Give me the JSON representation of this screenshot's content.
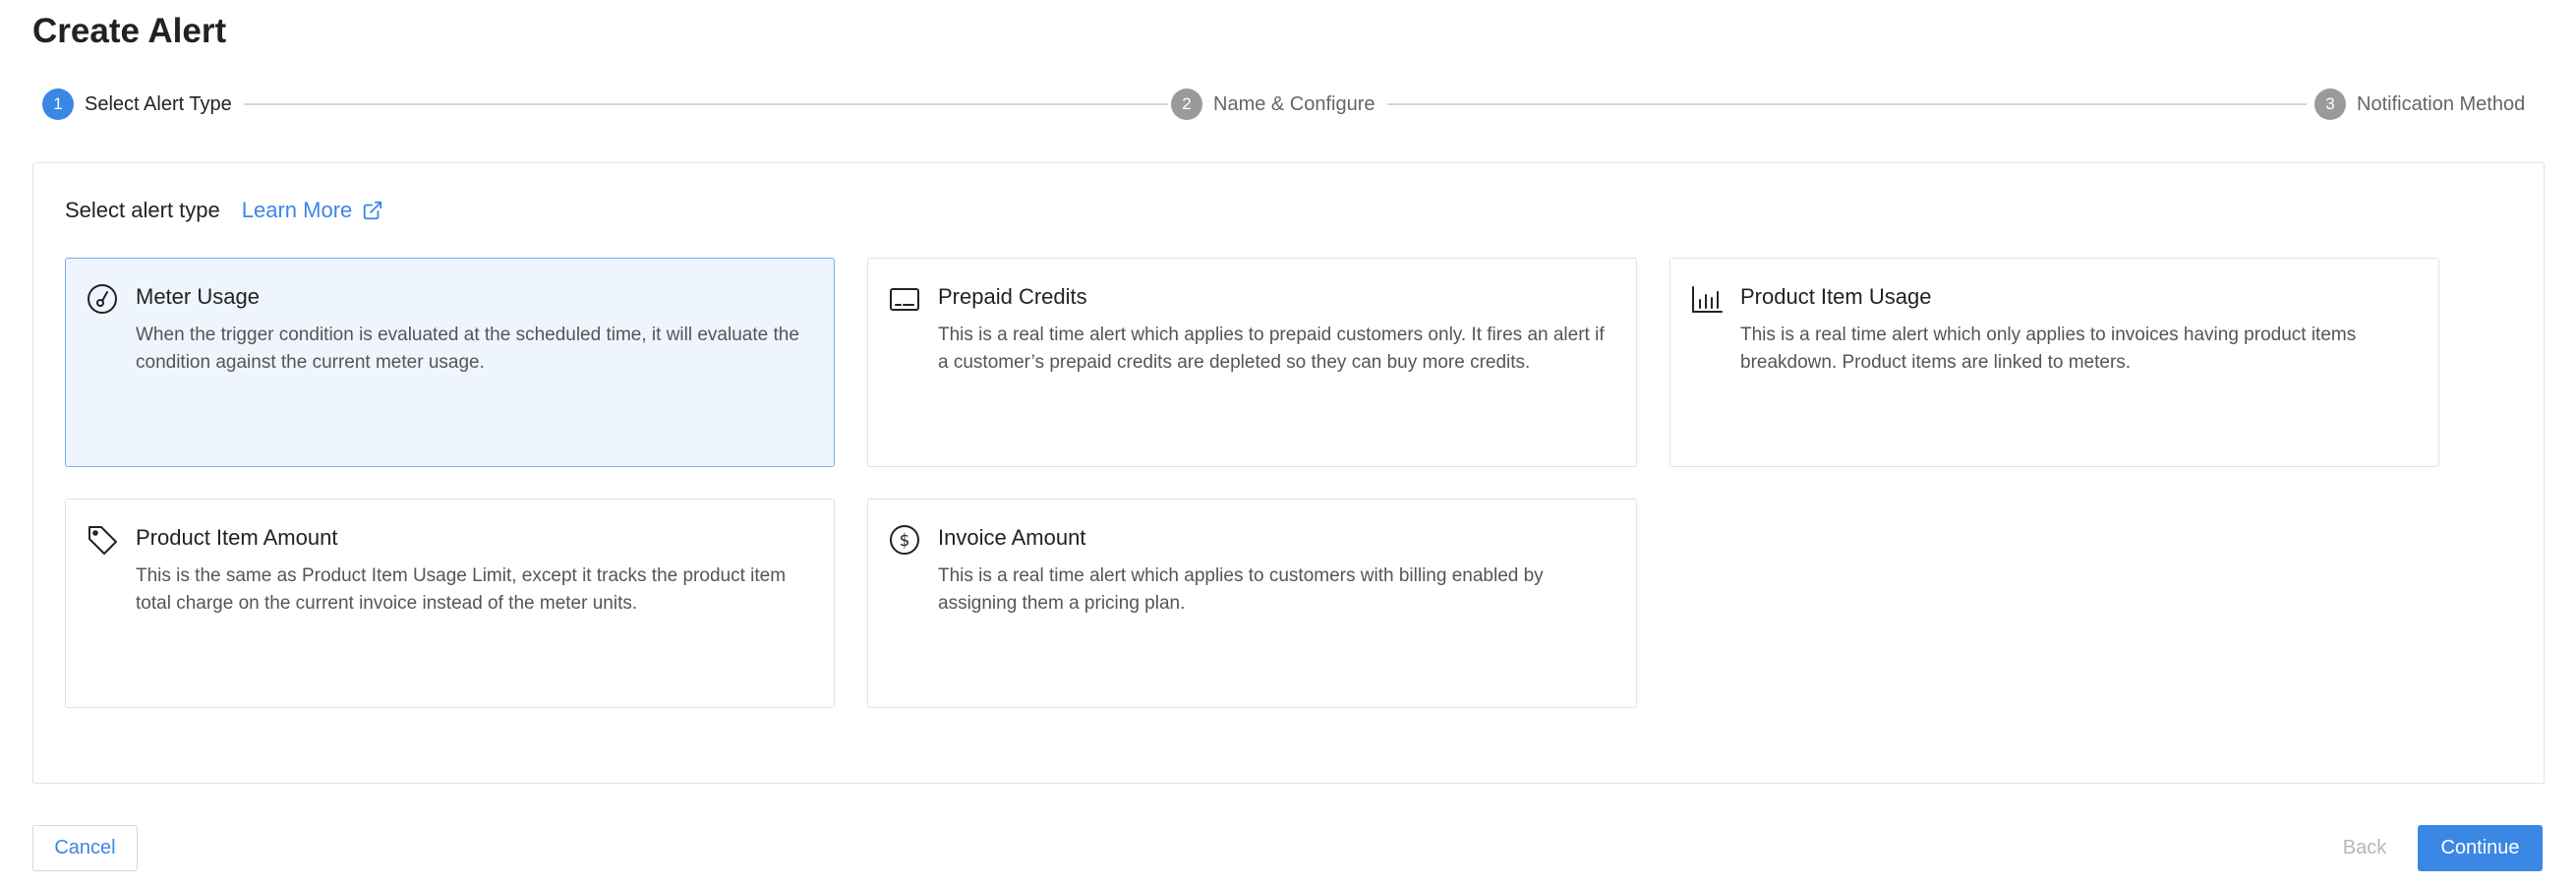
{
  "page": {
    "title": "Create Alert"
  },
  "stepper": {
    "steps": [
      {
        "number": "1",
        "label": "Select Alert Type",
        "state": "active"
      },
      {
        "number": "2",
        "label": "Name & Configure",
        "state": "pending"
      },
      {
        "number": "3",
        "label": "Notification Method",
        "state": "pending"
      }
    ]
  },
  "panel": {
    "section_label": "Select alert type",
    "learn_more_label": "Learn More",
    "cards": [
      {
        "title": "Meter Usage",
        "icon": "gauge-icon",
        "selected": true,
        "description": "When the trigger condition is evaluated at the scheduled time, it will evaluate the condition against the current meter usage."
      },
      {
        "title": "Prepaid Credits",
        "icon": "card-icon",
        "selected": false,
        "description": "This is a real time alert which applies to prepaid customers only. It fires an alert if a customer’s prepaid credits are depleted so they can buy more credits."
      },
      {
        "title": "Product Item Usage",
        "icon": "bar-chart-icon",
        "selected": false,
        "description": "This is a real time alert which only applies to invoices having product items breakdown. Product items are linked to meters."
      },
      {
        "title": "Product Item Amount",
        "icon": "tag-icon",
        "selected": false,
        "description": "This is the same as Product Item Usage Limit, except it tracks the product item total charge on the current invoice instead of the meter units."
      },
      {
        "title": "Invoice Amount",
        "icon": "dollar-circle-icon",
        "selected": false,
        "description": "This is a real time alert which applies to customers with billing enabled by assigning them a pricing plan."
      }
    ]
  },
  "footer": {
    "cancel_label": "Cancel",
    "back_label": "Back",
    "continue_label": "Continue"
  },
  "colors": {
    "accent": "#3b87e6",
    "selected_card_bg": "#eef5fd",
    "selected_card_border": "#7aaef0",
    "pending_step": "#9a9a9a"
  }
}
